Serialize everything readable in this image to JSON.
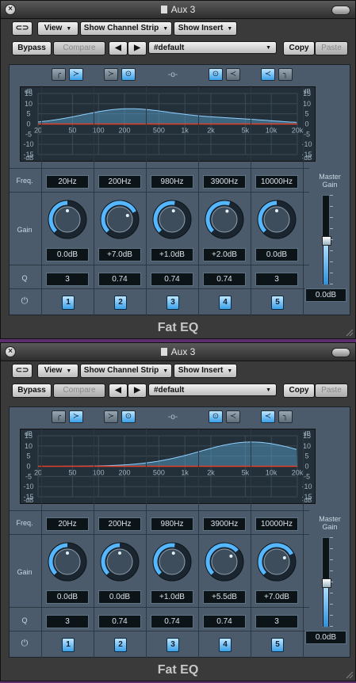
{
  "windows": [
    {
      "title": "Aux 3",
      "toolbar": {
        "link_icon": "link-icon",
        "view": "View",
        "show_channel_strip": "Show Channel Strip",
        "show_insert": "Show Insert",
        "bypass": "Bypass",
        "compare": "Compare",
        "prev": "◀",
        "next": "▶",
        "preset": "#default",
        "copy": "Copy",
        "paste": "Paste"
      },
      "plugin_name": "Fat EQ",
      "graph": {
        "db_top": "dB",
        "db_bottom": "-dB",
        "db_ticks": [
          "15",
          "10",
          "5",
          "0",
          "-5",
          "-10",
          "-15"
        ],
        "freq_ticks": [
          "20",
          "50",
          "100",
          "200",
          "500",
          "1k",
          "2k",
          "5k",
          "10k",
          "20k"
        ]
      },
      "labels": {
        "freq": "Freq.",
        "gain": "Gain",
        "q": "Q",
        "master": "Master Gain"
      },
      "bands": [
        {
          "freq": "20Hz",
          "gain": "0.0dB",
          "q": "3",
          "num": "1",
          "gain_db": 0
        },
        {
          "freq": "200Hz",
          "gain": "+7.0dB",
          "q": "0.74",
          "num": "2",
          "gain_db": 7
        },
        {
          "freq": "980Hz",
          "gain": "+1.0dB",
          "q": "0.74",
          "num": "3",
          "gain_db": 1
        },
        {
          "freq": "3900Hz",
          "gain": "+2.0dB",
          "q": "0.74",
          "num": "4",
          "gain_db": 2
        },
        {
          "freq": "10000Hz",
          "gain": "0.0dB",
          "q": "3",
          "num": "5",
          "gain_db": 0
        }
      ],
      "master_gain": "0.0dB",
      "master_level": 0.5
    },
    {
      "title": "Aux 3",
      "toolbar": {
        "link_icon": "link-icon",
        "view": "View",
        "show_channel_strip": "Show Channel Strip",
        "show_insert": "Show Insert",
        "bypass": "Bypass",
        "compare": "Compare",
        "prev": "◀",
        "next": "▶",
        "preset": "#default",
        "copy": "Copy",
        "paste": "Paste"
      },
      "plugin_name": "Fat EQ",
      "graph": {
        "db_top": "dB",
        "db_bottom": "-dB",
        "db_ticks": [
          "15",
          "10",
          "5",
          "0",
          "-5",
          "-10",
          "-15"
        ],
        "freq_ticks": [
          "20",
          "50",
          "100",
          "200",
          "500",
          "1k",
          "2k",
          "5k",
          "10k",
          "20k"
        ]
      },
      "labels": {
        "freq": "Freq.",
        "gain": "Gain",
        "q": "Q",
        "master": "Master Gain"
      },
      "bands": [
        {
          "freq": "20Hz",
          "gain": "0.0dB",
          "q": "3",
          "num": "1",
          "gain_db": 0
        },
        {
          "freq": "200Hz",
          "gain": "0.0dB",
          "q": "0.74",
          "num": "2",
          "gain_db": 0
        },
        {
          "freq": "980Hz",
          "gain": "+1.0dB",
          "q": "0.74",
          "num": "3",
          "gain_db": 1
        },
        {
          "freq": "3900Hz",
          "gain": "+5.5dB",
          "q": "0.74",
          "num": "4",
          "gain_db": 5.5
        },
        {
          "freq": "10000Hz",
          "gain": "+7.0dB",
          "q": "3",
          "num": "5",
          "gain_db": 7
        }
      ],
      "master_gain": "0.0dB",
      "master_level": 0.5
    }
  ]
}
